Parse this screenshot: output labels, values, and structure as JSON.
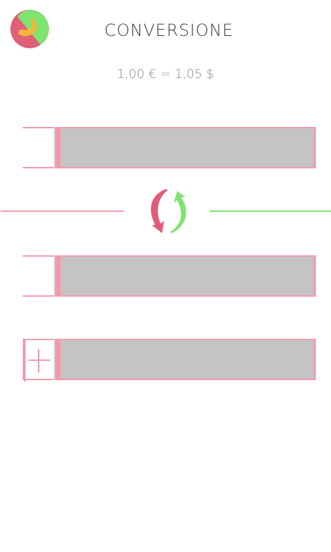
{
  "app": {
    "title": "CONVERSIONE",
    "logo_icon": "hand-logo-icon"
  },
  "rate": {
    "text": "1,00 € = 1,05 $"
  },
  "rows": [
    {
      "name": "currency-from-field",
      "value": ""
    },
    {
      "name": "currency-to-field",
      "value": ""
    },
    {
      "name": "add-currency-field",
      "value": ""
    }
  ],
  "swap": {
    "icon": "swap-arrows-icon"
  },
  "colors": {
    "pink": "#f29aaa",
    "green": "#7ee36f",
    "red_arrow": "#e05c78",
    "field_gray": "#c4c4c4"
  }
}
